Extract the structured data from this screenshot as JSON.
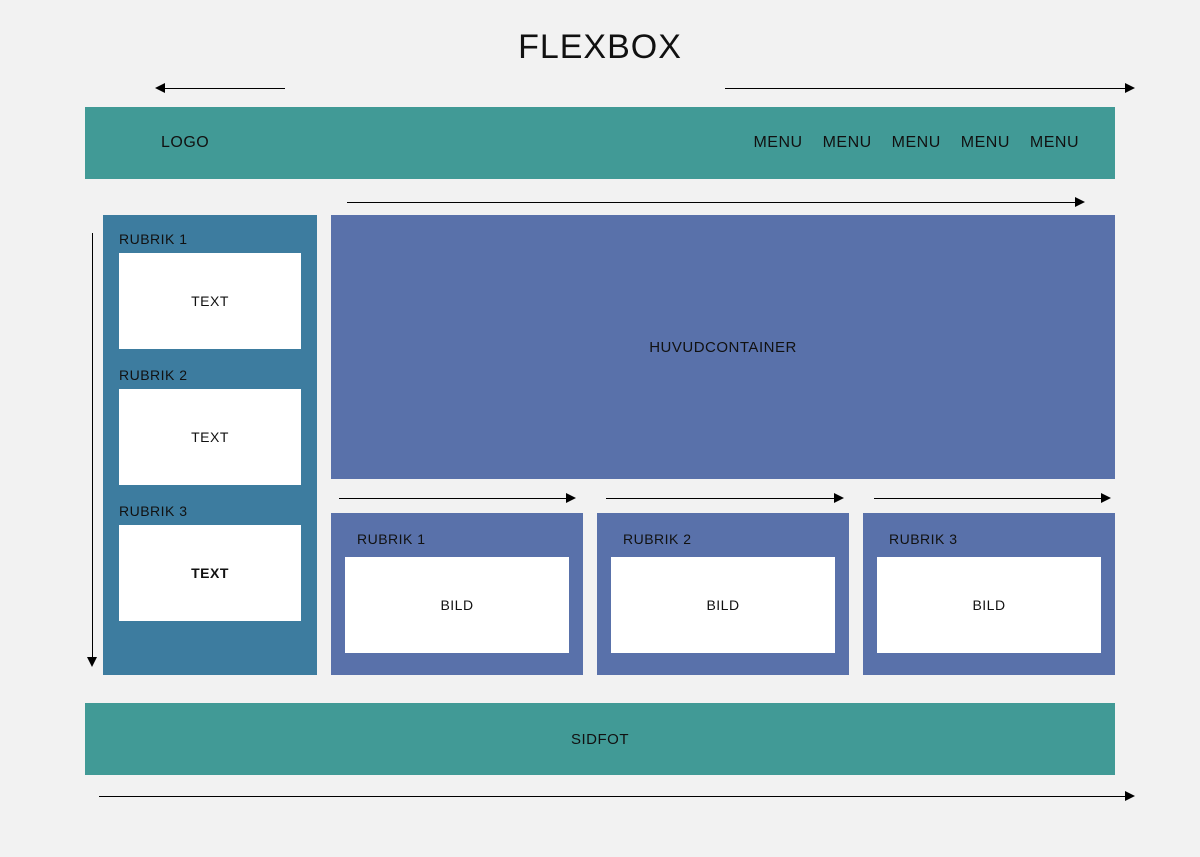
{
  "title": "FLEXBOX",
  "header": {
    "logo": "LOGO",
    "menu": [
      "MENU",
      "MENU",
      "MENU",
      "MENU",
      "MENU"
    ]
  },
  "sidebar": {
    "blocks": [
      {
        "title": "RUBRIK 1",
        "content": "TEXT"
      },
      {
        "title": "RUBRIK 2",
        "content": "TEXT"
      },
      {
        "title": "RUBRIK 3",
        "content": "TEXT"
      }
    ]
  },
  "main": {
    "label": "HUVUDCONTAINER"
  },
  "cards": [
    {
      "title": "RUBRIK 1",
      "content": "BILD"
    },
    {
      "title": "RUBRIK 2",
      "content": "BILD"
    },
    {
      "title": "RUBRIK 3",
      "content": "BILD"
    }
  ],
  "footer": {
    "label": "SIDFOT"
  },
  "colors": {
    "teal": "#419a96",
    "steelblue": "#3d7c9f",
    "slateblue": "#5971aa",
    "bg": "#f2f2f2",
    "white": "#ffffff"
  }
}
